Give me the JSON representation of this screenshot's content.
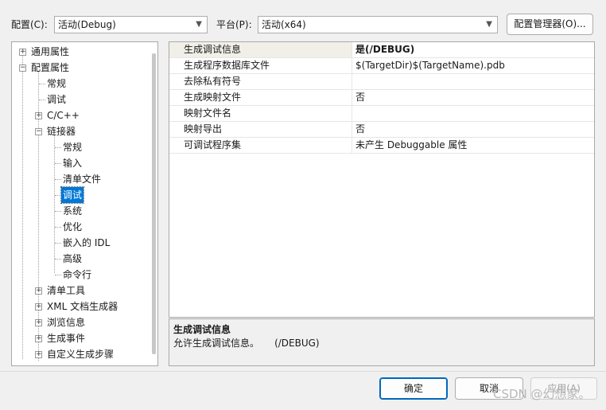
{
  "toolbar": {
    "config_label": "配置(C):",
    "config_value": "活动(Debug)",
    "platform_label": "平台(P):",
    "platform_value": "活动(x64)",
    "config_manager_button": "配置管理器(O)..."
  },
  "tree": {
    "general": "通用属性",
    "config_props": "配置属性",
    "conventional": "常规",
    "debugging": "调试",
    "cpp": "C/C++",
    "linker": "链接器",
    "linker_general": "常规",
    "linker_input": "输入",
    "linker_manifest": "清单文件",
    "linker_debug": "调试",
    "linker_system": "系统",
    "linker_optimize": "优化",
    "linker_embedded_idl": "嵌入的 IDL",
    "linker_advanced": "高级",
    "linker_cmdline": "命令行",
    "manifest_tool": "清单工具",
    "xml_doc": "XML 文档生成器",
    "browse_info": "浏览信息",
    "build_events": "生成事件",
    "custom_build": "自定义生成步骤"
  },
  "grid": {
    "rows": [
      {
        "name": "生成调试信息",
        "value": "是(/DEBUG)"
      },
      {
        "name": "生成程序数据库文件",
        "value": "$(TargetDir)$(TargetName).pdb"
      },
      {
        "name": "去除私有符号",
        "value": ""
      },
      {
        "name": "生成映射文件",
        "value": "否"
      },
      {
        "name": "映射文件名",
        "value": ""
      },
      {
        "name": "映射导出",
        "value": "否"
      },
      {
        "name": "可调试程序集",
        "value": "未产生 Debuggable 属性"
      }
    ]
  },
  "description": {
    "title": "生成调试信息",
    "text": "允许生成调试信息。     (/DEBUG)"
  },
  "buttons": {
    "ok": "确定",
    "cancel": "取消",
    "apply": "应用(A)"
  },
  "watermark": "CSDN @幻想家。",
  "colors": {
    "selection": "#0078d7",
    "default_button_border": "#0067c0"
  }
}
